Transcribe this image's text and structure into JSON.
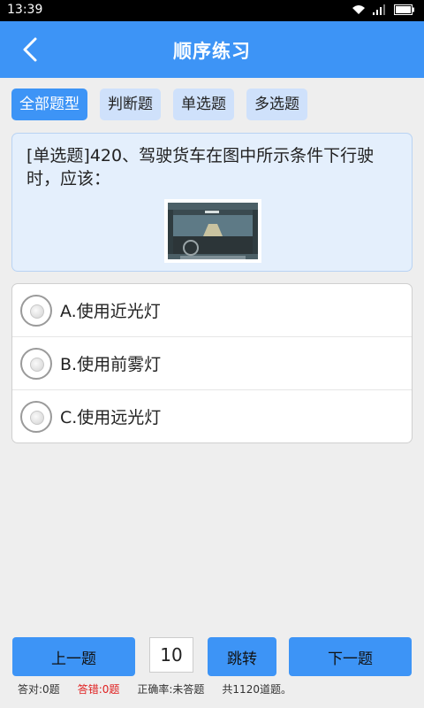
{
  "status_bar": {
    "time": "13:39",
    "icons": [
      "wifi-icon",
      "signal-icon",
      "battery-icon"
    ]
  },
  "header": {
    "title": "顺序练习",
    "back_icon": "chevron-left-icon"
  },
  "filters": [
    {
      "label": "全部题型",
      "active": true
    },
    {
      "label": "判断题",
      "active": false
    },
    {
      "label": "单选题",
      "active": false
    },
    {
      "label": "多选题",
      "active": false
    }
  ],
  "question": {
    "text": "[单选题]420、驾驶货车在图中所示条件下行驶时，应该：",
    "image": "truck-cab-night-road-image"
  },
  "options": [
    {
      "label": "A.使用近光灯"
    },
    {
      "label": "B.使用前雾灯"
    },
    {
      "label": "C.使用远光灯"
    }
  ],
  "footer": {
    "prev_label": "上一题",
    "page_value": "10",
    "jump_label": "跳转",
    "next_label": "下一题"
  },
  "stats": {
    "correct": "答对:0题",
    "wrong": "答错:0题",
    "accuracy": "正确率:未答题",
    "total": "共1120道题。"
  },
  "colors": {
    "accent": "#3d94f6",
    "tab_inactive": "#cfe1fb",
    "wrong": "#e02020"
  }
}
